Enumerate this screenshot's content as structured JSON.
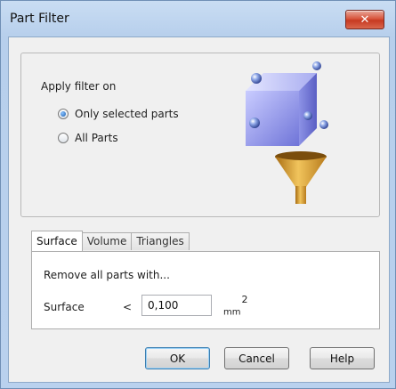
{
  "window": {
    "title": "Part Filter",
    "close_glyph": "✕"
  },
  "apply_filter": {
    "label": "Apply filter on",
    "options": [
      {
        "label": "Only selected parts",
        "selected": true
      },
      {
        "label": "All Parts",
        "selected": false
      }
    ],
    "illustration_icon": "cube-with-funnel-icon"
  },
  "tabs": [
    {
      "label": "Surface",
      "active": true
    },
    {
      "label": "Volume",
      "active": false
    },
    {
      "label": "Triangles",
      "active": false
    }
  ],
  "surface_panel": {
    "heading": "Remove all parts with...",
    "field_label": "Surface",
    "operator": "<",
    "value": "0,100",
    "unit": "mm",
    "unit_exponent": "2"
  },
  "buttons": {
    "ok": "OK",
    "cancel": "Cancel",
    "help": "Help"
  },
  "colors": {
    "title_bar": "#b9d1ee",
    "close_button": "#d8553d",
    "dialog_background": "#f0f0f0"
  }
}
